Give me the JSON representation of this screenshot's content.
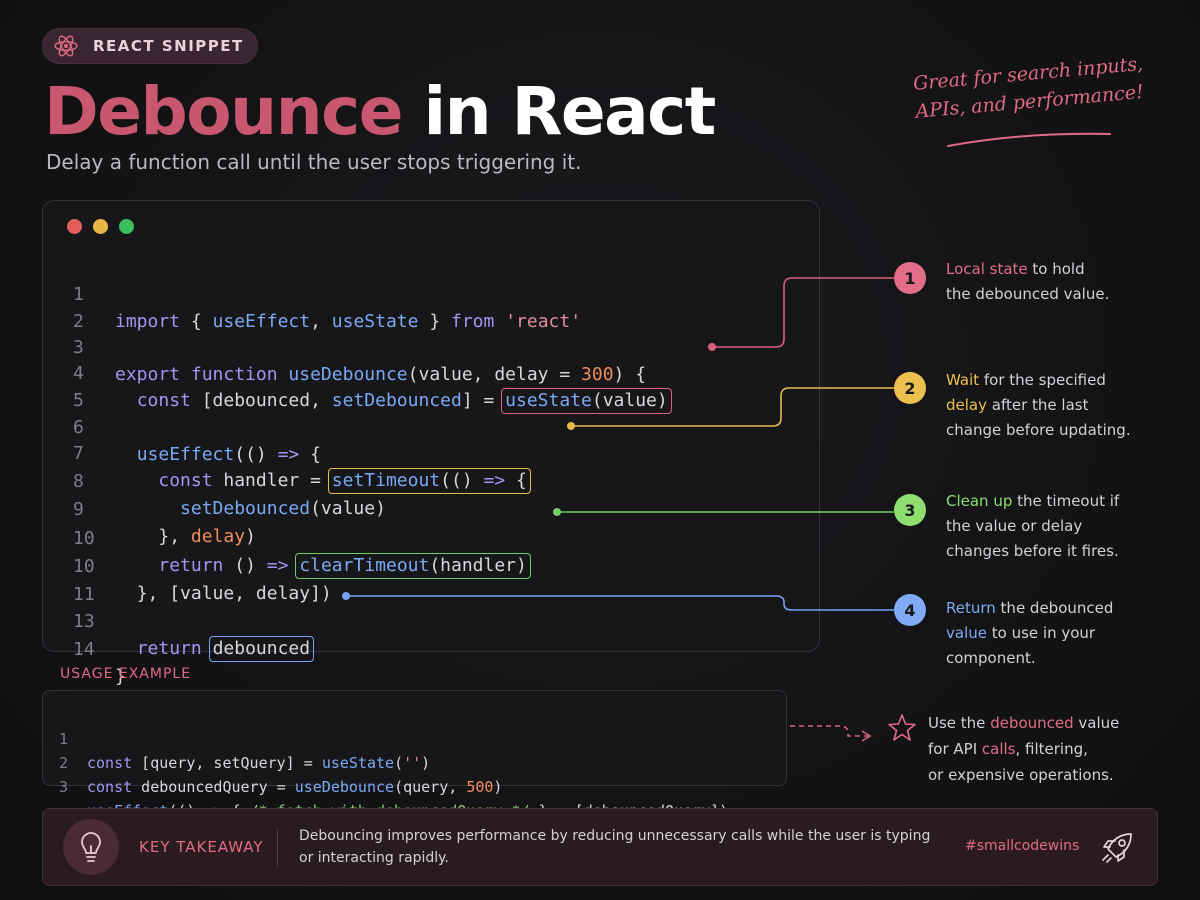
{
  "badge": {
    "label": "REACT SNIPPET",
    "icon": "react-atom-icon"
  },
  "title": {
    "part1": "Debounce",
    "part2": " in React"
  },
  "subtitle": "Delay a function call until the user stops triggering it.",
  "note": {
    "line1": "Great for search inputs,",
    "line2": "APIs, and performance!"
  },
  "colors": {
    "accent_pink": "#d9607c",
    "accent_yellow": "#e7bb4b",
    "accent_green": "#6fcf62",
    "accent_blue": "#7aa2f4",
    "background": "#141416"
  },
  "code": {
    "line_numbers": [
      "1",
      "2",
      "3",
      "4",
      "5",
      "6",
      "7",
      "8",
      "9",
      "10",
      "10",
      "11",
      "13",
      "14"
    ],
    "l1": {
      "kw": "import",
      "a": " { ",
      "b": "useEffect",
      "c": ", ",
      "d": "useState",
      "e": " } ",
      "f": "from",
      "g": " ",
      "h": "'react'"
    },
    "l3": {
      "kw": "export",
      "kw2": " function",
      "sp": " ",
      "fn": "useDebounce",
      "a": "(value, delay = ",
      "num": "300",
      "b": ") {"
    },
    "l4": {
      "kw": "const",
      "a": " [debounced, ",
      "fn": "setDebounced",
      "b": "] = ",
      "hl_fn": "useState",
      "hl_rest": "(value)"
    },
    "l6": {
      "fn": "useEffect",
      "a": "(() ",
      "arrow": "=>",
      "b": " {"
    },
    "l7": {
      "kw": "const",
      "a": " handler = ",
      "hl_fn": "setTimeout",
      "hl_a": "(() ",
      "hl_arrow": "=>",
      "hl_b": " {"
    },
    "l8": {
      "fn": "setDebounced",
      "a": "(value)"
    },
    "l9": {
      "a": "}, ",
      "num": "delay",
      "b": ")"
    },
    "l10a": {
      "kw": "return",
      "a": " () ",
      "arrow": "=>",
      "sp": " ",
      "hl_fn": "clearTimeout",
      "hl_rest": "(handler)"
    },
    "l10b": {
      "a": "}, [value, delay])"
    },
    "l13": {
      "kw": "return",
      "sp": " ",
      "hl": "debounced"
    },
    "l14": {
      "a": "}"
    }
  },
  "steps": [
    {
      "num": "1",
      "hl": "Local state",
      "rest1": " to hold",
      "line2": "the debounced value."
    },
    {
      "num": "2",
      "hl1": "Wait",
      "rest1": " for the specified",
      "hl2": "delay",
      "rest2": " after the last",
      "line3": "change before updating."
    },
    {
      "num": "3",
      "hl": "Clean up",
      "rest1": " the timeout if",
      "line2": "the value or delay",
      "line3": "changes before it fires."
    },
    {
      "num": "4",
      "hl1": "Return",
      "rest1": " the debounced",
      "hl2": "value",
      "rest2": " to use in your",
      "line3": "component."
    }
  ],
  "usage": {
    "label": "USAGE EXAMPLE",
    "line_numbers": [
      "1",
      "2",
      "3"
    ],
    "u1": {
      "kw": "const",
      "a": " [query, setQuery] = ",
      "fn": "useState",
      "b": "(",
      "str": "''",
      "c": ")"
    },
    "u2": {
      "kw": "const",
      "a": " debouncedQuery = ",
      "fn": "useDebounce",
      "b": "(query, ",
      "num": "500",
      "c": ")"
    },
    "u3": {
      "fn": "useEffect",
      "a": "(() => { ",
      "cm": "/* fetch with debouncedQuery */",
      "b": " },  [debouncedQuery])"
    },
    "tip": {
      "a": "Use the ",
      "hl": "debounced",
      "b": " value",
      "line2a": "for API ",
      "hl2": "calls",
      "line2b": ", filtering,",
      "line3": "or expensive operations."
    },
    "tip_icon": "star-icon"
  },
  "takeaway": {
    "icon": "lightbulb-icon",
    "label": "KEY TAKEAWAY",
    "text": "Debouncing improves performance by reducing unnecessary calls while the user is typing or interacting rapidly.",
    "tag": "#smallcodewins",
    "tag_icon": "rocket-icon"
  }
}
